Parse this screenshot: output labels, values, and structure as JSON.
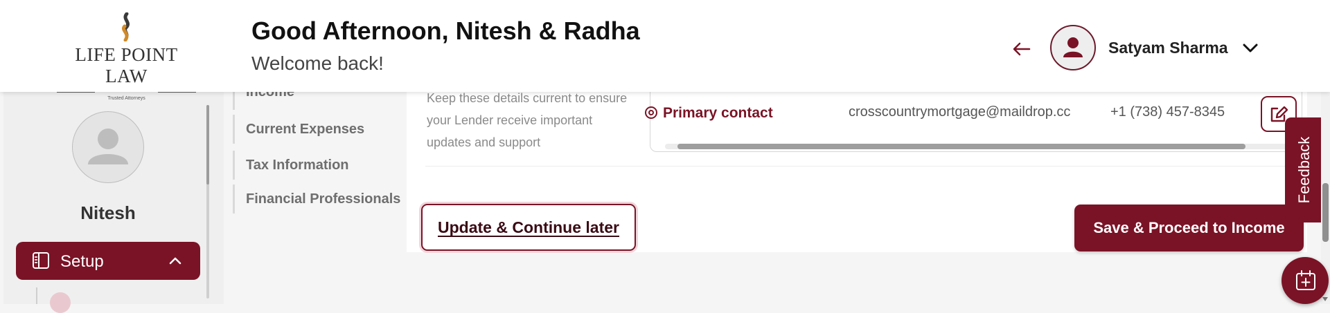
{
  "header": {
    "logo": {
      "name": "LIFE POINT LAW",
      "tagline": "Trusted Attorneys"
    },
    "greeting": "Good Afternoon, Nitesh & Radha",
    "welcome": "Welcome back!",
    "back_icon": "arrow-left-icon",
    "user": {
      "name": "Satyam Sharma",
      "menu_icon": "chevron-down-icon"
    }
  },
  "sidebar": {
    "profile_name": "Nitesh",
    "setup": {
      "label": "Setup",
      "icon": "book-icon",
      "expanded": true
    }
  },
  "subnav": {
    "items": [
      {
        "label": "Income"
      },
      {
        "label": "Current Expenses"
      },
      {
        "label": "Tax Information"
      },
      {
        "label": "Financial Professionals"
      }
    ]
  },
  "main": {
    "contact_description": "Keep these details current to ensure your Lender receive important updates and support",
    "contact": {
      "type": "Primary contact",
      "email": "crosscountrymortgage@maildrop.cc",
      "phone": "+1 (738) 457-8345"
    },
    "actions": {
      "update_later": "Update & Continue later",
      "proceed": "Save & Proceed to Income"
    }
  },
  "feedback_label": "Feedback",
  "colors": {
    "brand": "#7a1326",
    "background": "#f5f5f5",
    "surface": "#ffffff"
  }
}
